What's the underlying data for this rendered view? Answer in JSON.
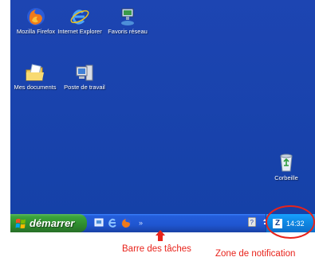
{
  "desktop": {
    "icons": [
      {
        "label": "Mozilla Firefox",
        "icon": "firefox-icon"
      },
      {
        "label": "Internet Explorer",
        "icon": "ie-icon"
      },
      {
        "label": "Favoris réseau",
        "icon": "network-icon"
      },
      {
        "label": "Mes documents",
        "icon": "documents-folder-icon"
      },
      {
        "label": "Poste de travail",
        "icon": "computer-icon"
      },
      {
        "label": "Corbeille",
        "icon": "recycle-bin-icon"
      }
    ]
  },
  "taskbar": {
    "start_label": "démarrer",
    "quick_launch": [
      "show-desktop-icon",
      "ie-quick-icon",
      "firefox-quick-icon"
    ],
    "chevron": "»",
    "clock": "14:32"
  },
  "annotations": {
    "taskbar_label": "Barre des tâches",
    "notification_label": "Zone de notification"
  },
  "colors": {
    "desktop": "#1541a8",
    "start_button": "#3aa43a",
    "annotation": "#e8231b"
  }
}
